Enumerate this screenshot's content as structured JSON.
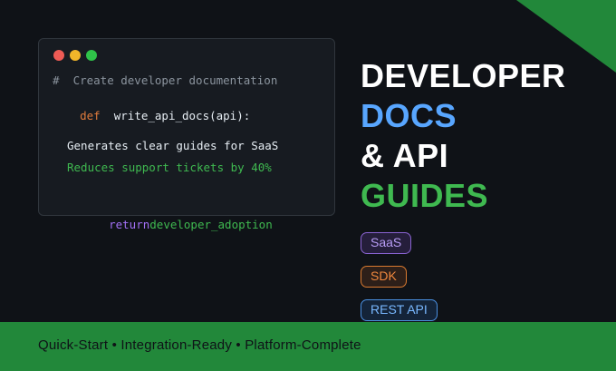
{
  "code": {
    "comment": "#  Create developer documentation",
    "keyword_def": "def",
    "signature": "write_api_docs(api):",
    "line_generates": "Generates clear guides for SaaS",
    "line_reduces": "Reduces support tickets by 40%",
    "keyword_return": "return",
    "return_value": "developer_adoption"
  },
  "headline": {
    "line1": "DEVELOPER",
    "line2": "DOCS",
    "line3": "& API",
    "line4": "GUIDES"
  },
  "tags": {
    "saas": "SaaS",
    "sdk": "SDK",
    "rest_api": "REST API"
  },
  "footer": {
    "text": "Quick-Start • Integration-Ready • Platform-Complete"
  },
  "colors": {
    "background": "#0f1217",
    "accent_green": "#22883a",
    "headline_blue": "#58a6ff",
    "headline_green": "#3fb950"
  }
}
